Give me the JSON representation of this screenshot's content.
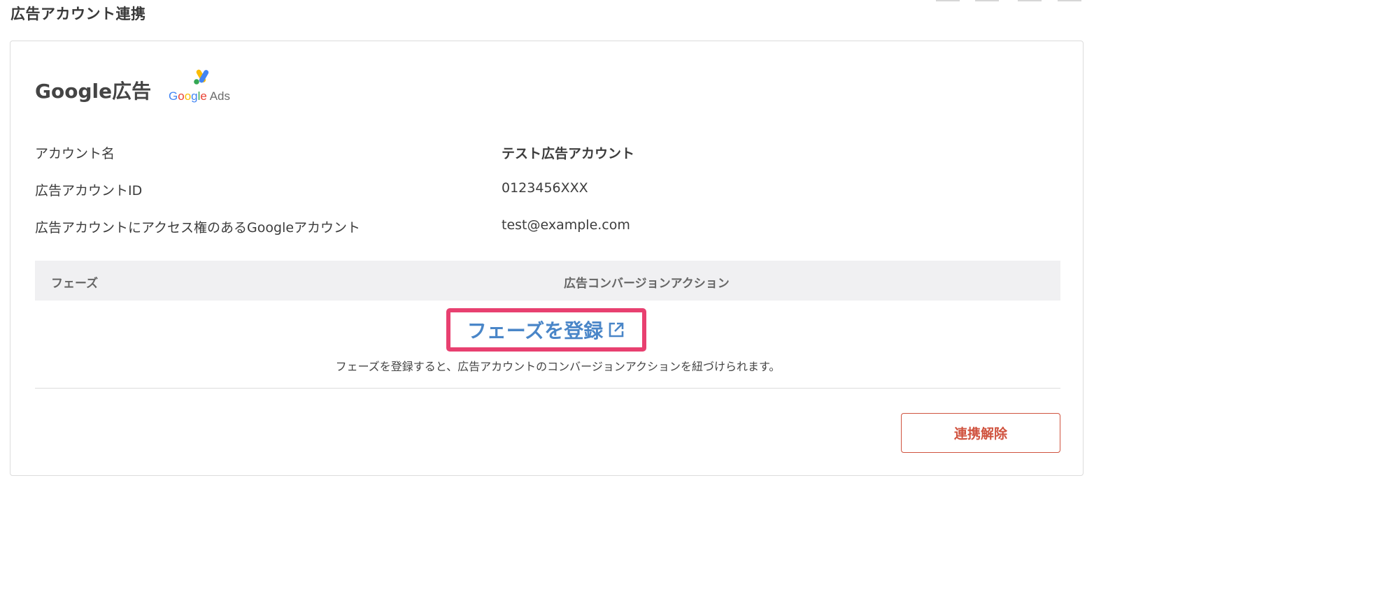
{
  "page": {
    "title": "広告アカウント連携"
  },
  "provider": {
    "title": "Google広告",
    "logo_text": {
      "google_letters": [
        "G",
        "o",
        "o",
        "g",
        "l",
        "e"
      ],
      "ads": "Ads"
    }
  },
  "account_info": [
    {
      "label": "アカウント名",
      "value": "テスト広告アカウント"
    },
    {
      "label": "広告アカウントID",
      "value": "0123456XXX"
    },
    {
      "label": "広告アカウントにアクセス権のあるGoogleアカウント",
      "value": "test@example.com"
    }
  ],
  "table": {
    "headers": [
      "フェーズ",
      "広告コンバージョンアクション"
    ]
  },
  "register": {
    "link_label": "フェーズを登録",
    "hint": "フェーズを登録すると、広告アカウントのコンバージョンアクションを紐づけられます。"
  },
  "actions": {
    "unlink_label": "連携解除"
  },
  "colors": {
    "link": "#4a86c8",
    "highlight_border": "#e84070",
    "danger": "#d0533f",
    "table_header_bg": "#f0f0f2"
  }
}
